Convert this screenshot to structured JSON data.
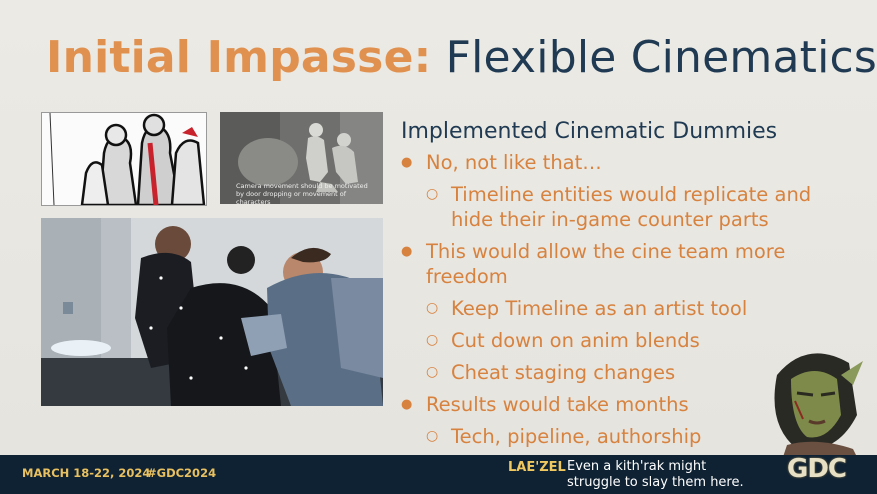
{
  "slide": {
    "title_highlight": "Initial Impasse:",
    "title_rest": "Flexible Cinematics",
    "subheading": "Implemented Cinematic Dummies",
    "bullets": [
      {
        "level": 1,
        "text": "No, not like that…"
      },
      {
        "level": 2,
        "text": "Timeline entities would replicate and hide their in-game counter parts"
      },
      {
        "level": 1,
        "text": "This would allow the cine team more freedom"
      },
      {
        "level": 2,
        "text": "Keep Timeline as an artist tool"
      },
      {
        "level": 2,
        "text": "Cut down on anim blends"
      },
      {
        "level": 2,
        "text": "Cheat staging changes"
      },
      {
        "level": 1,
        "text": "Results would take months"
      },
      {
        "level": 2,
        "text": "Tech, pipeline, authorship"
      }
    ],
    "image_caption": "Camera movement should be motivated by door dropping or movement of characters"
  },
  "footer": {
    "dates": "MARCH 18-22, 2024",
    "hashtag": "#GDC2024",
    "speaker": "LAE'ZEL",
    "quote_line1": "Even a kith'rak might",
    "quote_line2": "struggle to slay them here.",
    "logo": "GDC"
  },
  "colors": {
    "accent": "#e0914f",
    "title_dark": "#1f3a52",
    "footer_bg": "#0f2233",
    "footer_gold": "#e8c060"
  }
}
